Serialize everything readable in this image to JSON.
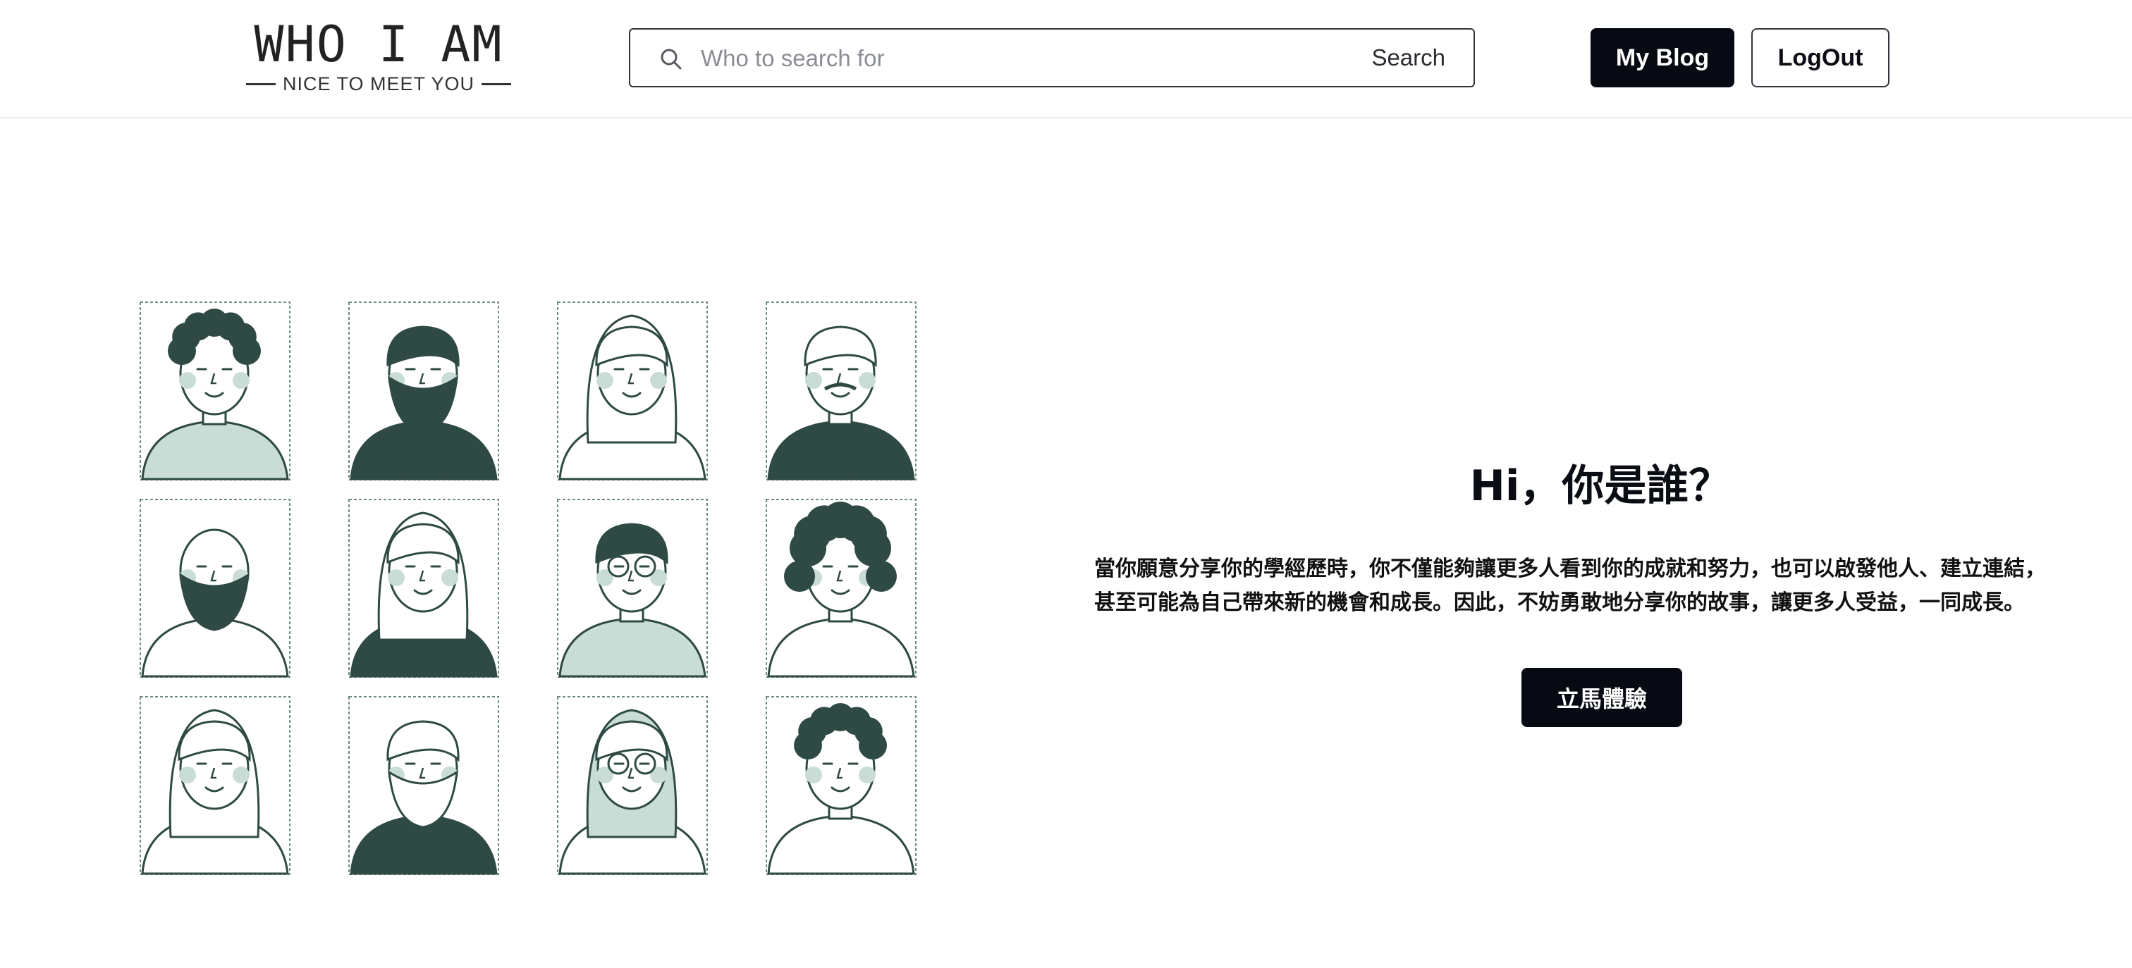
{
  "header": {
    "logo_title": "WHO I AM",
    "logo_subtitle": "NICE TO MEET YOU",
    "search": {
      "placeholder": "Who to search for",
      "value": "",
      "button_label": "Search"
    },
    "blog_button": "My Blog",
    "logout_button": "LogOut"
  },
  "hero": {
    "title": "Hi，你是誰？",
    "description_lines": [
      "當你願意分享你的學經歷時，你不僅能夠讓更多人看到你的成就和努力，也可以啟發他人、建立連結，",
      "甚至可能為自己帶來新的機會和成長。因此，不妨勇敢地分享你的故事，讓更多人受益，一同成長。"
    ],
    "cta_label": "立馬體驗"
  },
  "illustration": {
    "rows": 3,
    "columns": 4,
    "accent_color": "#2f4a44",
    "fill_color": "#c9ddd6",
    "frame_color": "#6e8a83"
  },
  "theme": {
    "primary_dark": "#070a12",
    "border": "#31343c",
    "placeholder": "#8a8d94"
  }
}
